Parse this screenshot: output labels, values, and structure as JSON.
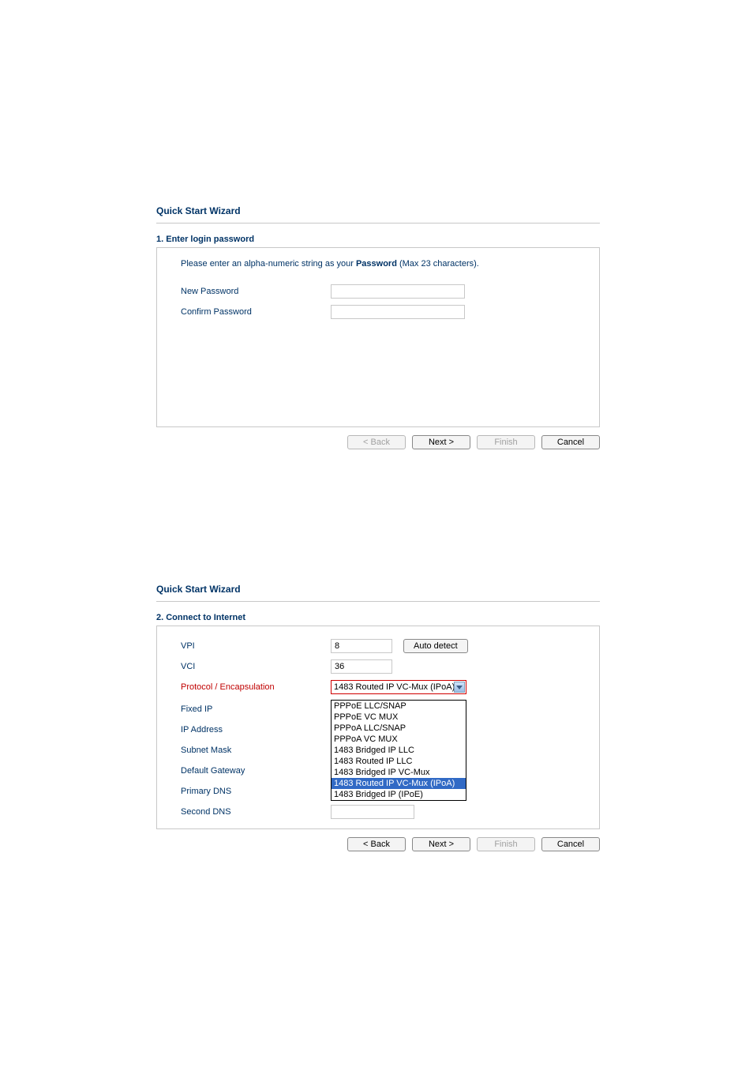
{
  "panel1": {
    "title": "Quick Start Wizard",
    "step_title": "1. Enter login password",
    "intro_pre": "Please enter an alpha-numeric string as your  ",
    "intro_bold": "Password",
    "intro_post": " (Max 23 characters).",
    "fields": {
      "new_password_label": "New Password",
      "new_password_value": "",
      "confirm_password_label": "Confirm Password",
      "confirm_password_value": ""
    },
    "buttons": {
      "back": "< Back",
      "next": "Next >",
      "finish": "Finish",
      "cancel": "Cancel"
    }
  },
  "panel2": {
    "title": "Quick Start Wizard",
    "step_title": "2. Connect to Internet",
    "fields": {
      "vpi_label": "VPI",
      "vpi_value": "8",
      "auto_detect": "Auto detect",
      "vci_label": "VCI",
      "vci_value": "36",
      "protocol_label": "Protocol / Encapsulation",
      "protocol_selected": "1483 Routed IP VC-Mux (IPoA)",
      "protocol_options": [
        "PPPoE LLC/SNAP",
        "PPPoE VC MUX",
        "PPPoA LLC/SNAP",
        "PPPoA VC MUX",
        "1483 Bridged IP LLC",
        "1483 Routed IP LLC",
        "1483 Bridged IP VC-Mux",
        "1483 Routed IP VC-Mux (IPoA)",
        "1483 Bridged IP (IPoE)"
      ],
      "protocol_selected_index": 7,
      "fixed_ip_label": "Fixed IP",
      "ip_address_label": "IP Address",
      "subnet_mask_label": "Subnet Mask",
      "default_gateway_label": "Default Gateway",
      "primary_dns_label": "Primary DNS",
      "primary_dns_value": "",
      "second_dns_label": "Second DNS",
      "second_dns_value": ""
    },
    "buttons": {
      "back": "< Back",
      "next": "Next >",
      "finish": "Finish",
      "cancel": "Cancel"
    }
  }
}
